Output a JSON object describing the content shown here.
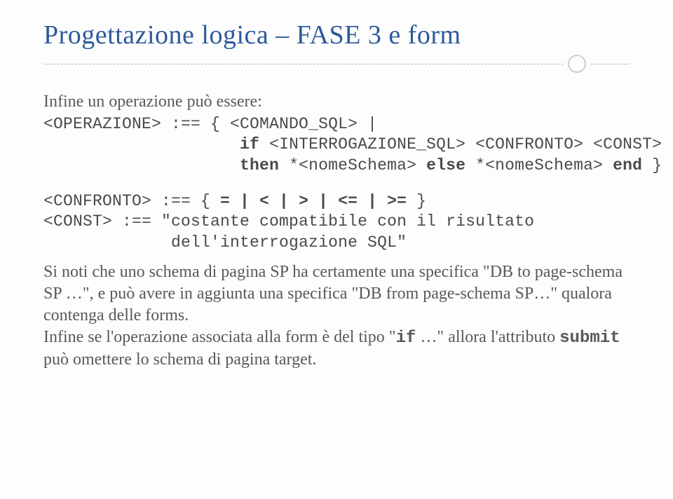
{
  "title": "Progettazione logica – FASE 3 e form",
  "intro": "Infine un operazione può essere:",
  "code1_l1a": "<OPERAZIONE> :== { <COMANDO_SQL> |",
  "code1_l2a": "                    ",
  "code1_l2_if": "if",
  "code1_l2b": " <INTERROGAZIONE_SQL> <CONFRONTO> <CONST>",
  "code1_l3a": "                    ",
  "code1_l3_then": "then",
  "code1_l3b": " *<nomeSchema>",
  "code1_l3_else": " else",
  "code1_l3c": " *<nomeSchema>",
  "code1_l3_end": " end",
  "code1_l3d": " }",
  "code2_l1a": "<CONFRONTO> :== { ",
  "code2_l1_ops": "= | < | > | <= | >=",
  "code2_l1b": " }",
  "code2_l2": "<CONST> :== \"costante compatibile con il risultato",
  "code2_l3": "             dell'interrogazione SQL\"",
  "para2_a": "Si noti che uno schema di pagina SP ha certamente una specifica \"DB to page-schema SP …\", e può avere in aggiunta una specifica \"DB from page-schema SP…\" qualora contenga delle forms.",
  "para2_b_pre": "Infine se l'operazione associata alla form è del tipo \"",
  "para2_b_if": "if",
  "para2_b_mid": " …\" allora l'attributo ",
  "para2_b_submit": "submit",
  "para2_b_post": " può omettere lo schema di pagina target."
}
